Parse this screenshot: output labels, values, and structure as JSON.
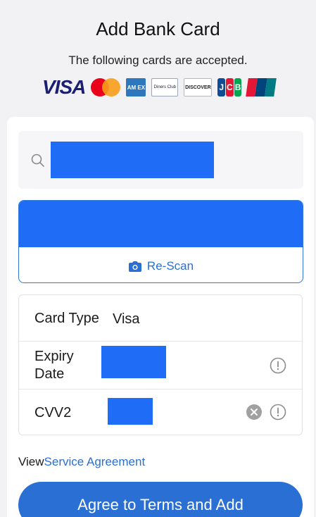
{
  "header": {
    "title": "Add Bank Card",
    "subtitle": "The following cards are accepted."
  },
  "logos": {
    "visa": "VISA",
    "amex": "AM EX",
    "diners": "Diners Club",
    "discover": "DISCOVER",
    "jcb": [
      "J",
      "C",
      "B"
    ],
    "unionpay": "UnionPay"
  },
  "rescan": {
    "label": "Re-Scan"
  },
  "details": {
    "card_type_label": "Card Type",
    "card_type_value": "Visa",
    "expiry_label_line1": "Expiry",
    "expiry_label_line2": "Date",
    "cvv_label": "CVV2"
  },
  "agreement": {
    "prefix": "View",
    "link": "Service Agreement"
  },
  "agree_button": {
    "label": "Agree to Terms and Add"
  },
  "colors": {
    "accent": "#2a6fd4",
    "redaction": "#1f6cf6",
    "background": "#f2f2f4"
  }
}
